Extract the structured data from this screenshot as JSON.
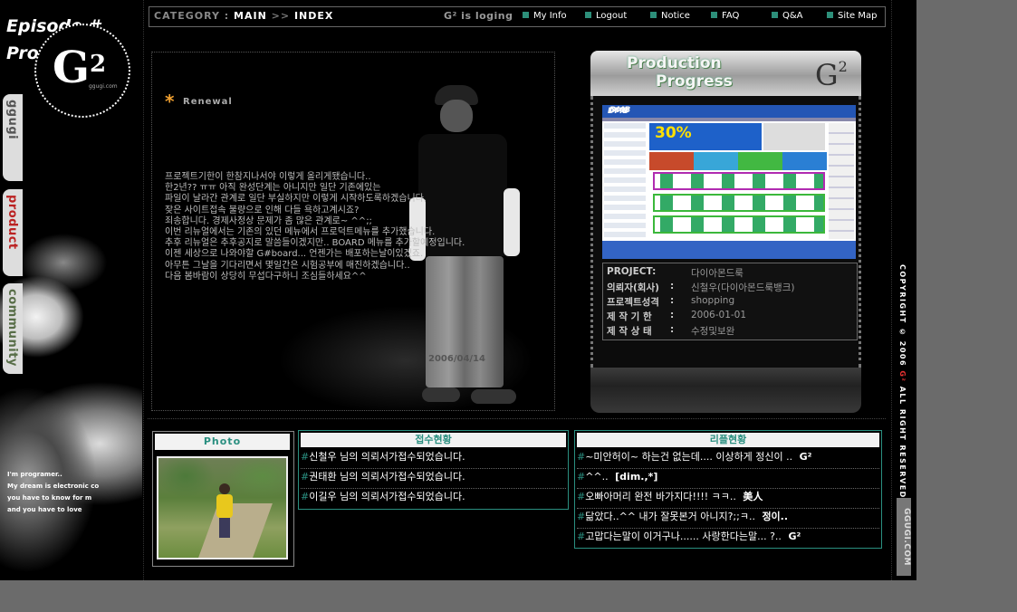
{
  "left": {
    "episode_title": "Episode #",
    "episode_sub": "Prog",
    "logo_main": "G",
    "logo_sup": "2",
    "logo_sub": "ggugi.com",
    "tabs": [
      {
        "label": "ggugi"
      },
      {
        "label": "product"
      },
      {
        "label": "community"
      }
    ],
    "programmer_lines": [
      "I'm programer..",
      "My dream is electronic co",
      "you have to know for m",
      "and you have to love"
    ]
  },
  "topbar": {
    "category_label": "CATEGORY :",
    "crumb_main": "MAIN",
    "crumb_sep": ">>",
    "crumb_index": "INDEX",
    "login_status": "G² is loging",
    "links": [
      "My Info",
      "Logout",
      "Notice",
      "FAQ",
      "Q&A",
      "Site Map"
    ]
  },
  "renewal": {
    "title": "Renewal",
    "lines": [
      "프로젝트기한이 한참지나서야 이렇게 올리게됐습니다..",
      "한2년?? ㅠㅠ 아직 완성단계는 아니지만 일단 기존에있는",
      "파일이 날라간 관계로 일단 부실하지만 이렇게 시작하도록하겠습니다.",
      "잦은 사이트접속 불량으로 인해 다들 욕하고계시죠?",
      "죄송합니다. 경제사정상 문제가 좀 많은 관계로~ ^^;;",
      "이번 리뉴얼에서는 기존의 있던 메뉴에서 프로덕트메뉴를 추가했습니다.",
      "추후 리뉴얼은 추후공지로 말씀들이겠지만.. BOARD 메뉴를 추가할예정입니다.",
      "이젠 세상으로 나와야할 G#board... 언젠가는 배포하는날이있겠죠.",
      "아무튼 그날을 기다리면서 몇일간은 시험공부에 매진하겠습니다..",
      "다음 봄바람이 상당히 무섭다구하니 조심들하세요^^"
    ],
    "date": "2006/04/14"
  },
  "production": {
    "title_line1": "Production",
    "title_line2": "Progress",
    "logo_main": "G",
    "logo_sup": "2",
    "screenshot": {
      "brand": "DMB",
      "promo": "30%"
    },
    "info": [
      {
        "key": "PROJECT:",
        "sep": "",
        "value": "다이아몬드룩"
      },
      {
        "key": "의뢰자(회사)",
        "sep": ":",
        "value": "신철우(다이아몬드룩뱅크)"
      },
      {
        "key": "프로젝트성격",
        "sep": ":",
        "value": "shopping"
      },
      {
        "key": "제 작 기 한",
        "sep": ":",
        "value": "2006-01-01"
      },
      {
        "key": "제 작 상 태",
        "sep": ":",
        "value": "수정및보완"
      }
    ]
  },
  "photo": {
    "title": "Photo"
  },
  "visits": {
    "title": "접수현황",
    "items": [
      "신철우 님의 의뢰서가접수되었습니다.",
      "권태환 님의 의뢰서가접수되었습니다.",
      "이길우 님의 의뢰서가접수되었습니다."
    ]
  },
  "replies": {
    "title": "리플현황",
    "items": [
      {
        "text": "~미안허이~ 하는건 없는데.... 이상하게 정신이 .. ",
        "nick": "G²"
      },
      {
        "text": "^^.. ",
        "nick": "[dim.,*]"
      },
      {
        "text": "오빠아머리 완전 바가지다!!!! ㅋㅋ.. ",
        "nick": "美人"
      },
      {
        "text": "닮았다..^^ 내가 잘못본거 아니지?;;ㅋ.. ",
        "nick": "정이.."
      },
      {
        "text": "고맙다는말이 이거구나...... 사랑한다는말... ?.. ",
        "nick": "G²"
      }
    ]
  },
  "right": {
    "copyright": "COPYRIGHT © 2006",
    "copyright_brand": "G²",
    "copyright_tail": "ALL RIGHT RESERVED",
    "site": "GGUGI.COM"
  },
  "colors": {
    "accent": "#2a8f80",
    "background": "#000000",
    "outer": "#6b6b6b"
  }
}
